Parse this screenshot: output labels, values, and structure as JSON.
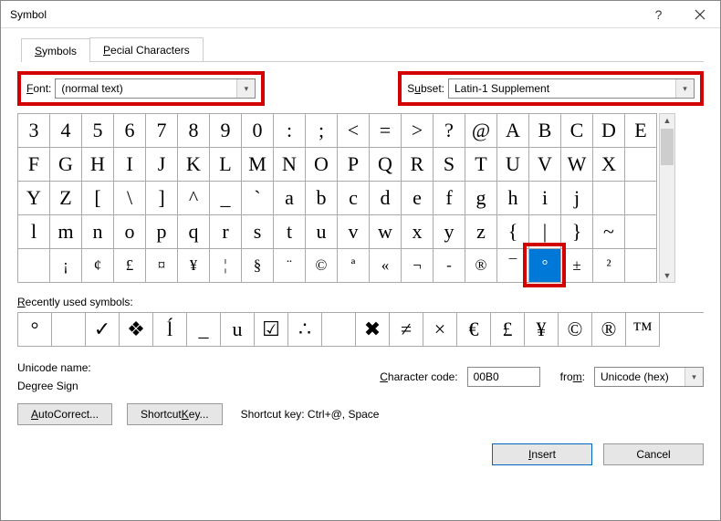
{
  "window": {
    "title": "Symbol"
  },
  "tabs": {
    "symbols": "Symbols",
    "special": "Special Characters"
  },
  "font": {
    "label_prefix": "F",
    "label_rest": "ont:",
    "value": "(normal text)"
  },
  "subset": {
    "label_prefix": "S",
    "label_rest": "ubset:",
    "value": "Latin-1 Supplement"
  },
  "grid": {
    "rows": [
      [
        "3",
        "4",
        "5",
        "6",
        "7",
        "8",
        "9",
        "0",
        ":",
        ";",
        "<",
        "=",
        ">",
        "?",
        "@",
        "A",
        "B",
        "C",
        "D",
        "E"
      ],
      [
        "F",
        "G",
        "H",
        "I",
        "J",
        "K",
        "L",
        "M",
        "N",
        "O",
        "P",
        "Q",
        "R",
        "S",
        "T",
        "U",
        "V",
        "W",
        "X"
      ],
      [
        "Y",
        "Z",
        "[",
        "\\",
        "]",
        "^",
        "_",
        "`",
        "a",
        "b",
        "c",
        "d",
        "e",
        "f",
        "g",
        "h",
        "i",
        "j"
      ],
      [
        "l",
        "m",
        "n",
        "o",
        "p",
        "q",
        "r",
        "s",
        "t",
        "u",
        "v",
        "w",
        "x",
        "y",
        "z",
        "{",
        "|",
        "}",
        "~"
      ],
      [
        "",
        "¡",
        "¢",
        "£",
        "¤",
        "¥",
        "¦",
        "§",
        "¨",
        "©",
        "ª",
        "«",
        "¬",
        "-",
        "®",
        "¯",
        "°",
        "±",
        "²"
      ]
    ],
    "selected": {
      "row": 4,
      "col": 16
    }
  },
  "recent": {
    "label_prefix": "R",
    "label_rest": "ecently used symbols:",
    "items": [
      "°",
      "",
      "✓",
      "❖",
      "ĺ",
      "_",
      "u",
      "☑",
      "∴",
      "",
      "✖",
      "≠",
      "×",
      "€",
      "£",
      "¥",
      "©",
      "®",
      "™"
    ]
  },
  "unicodeName": {
    "label": "Unicode name:",
    "value": "Degree Sign"
  },
  "charCode": {
    "label_prefix": "C",
    "label_rest": "haracter code:",
    "value": "00B0"
  },
  "from": {
    "label_prefix": "fro",
    "label_u": "m",
    "label_rest": ":",
    "value": "Unicode (hex)"
  },
  "buttons": {
    "autocorrect_prefix": "A",
    "autocorrect_rest": "utoCorrect...",
    "shortcutkey_prefix": "Shortcut ",
    "shortcutkey_u": "K",
    "shortcutkey_rest": "ey...",
    "shortcutStatic": "Shortcut key: Ctrl+@, Space",
    "insert_prefix": "I",
    "insert_rest": "nsert",
    "cancel": "Cancel"
  }
}
